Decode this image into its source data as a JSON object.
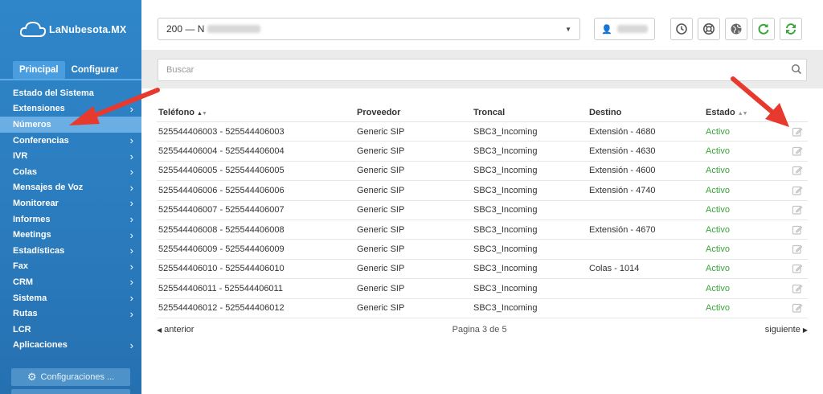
{
  "app": {
    "brand": "LaNubesota.MX"
  },
  "sidebar": {
    "tabs": [
      {
        "label": "Principal",
        "active": true
      },
      {
        "label": "Configurar",
        "active": false
      }
    ],
    "items": [
      {
        "label": "Estado del Sistema",
        "has_children": false,
        "active": false
      },
      {
        "label": "Extensiones",
        "has_children": true,
        "active": false
      },
      {
        "label": "Números",
        "has_children": false,
        "active": true
      },
      {
        "label": "Conferencias",
        "has_children": true,
        "active": false
      },
      {
        "label": "IVR",
        "has_children": true,
        "active": false
      },
      {
        "label": "Colas",
        "has_children": true,
        "active": false
      },
      {
        "label": "Mensajes de Voz",
        "has_children": true,
        "active": false
      },
      {
        "label": "Monitorear",
        "has_children": true,
        "active": false
      },
      {
        "label": "Informes",
        "has_children": true,
        "active": false
      },
      {
        "label": "Meetings",
        "has_children": true,
        "active": false
      },
      {
        "label": "Estadísticas",
        "has_children": true,
        "active": false
      },
      {
        "label": "Fax",
        "has_children": true,
        "active": false
      },
      {
        "label": "CRM",
        "has_children": true,
        "active": false
      },
      {
        "label": "Sistema",
        "has_children": true,
        "active": false
      },
      {
        "label": "Rutas",
        "has_children": true,
        "active": false
      },
      {
        "label": "LCR",
        "has_children": false,
        "active": false
      },
      {
        "label": "Aplicaciones",
        "has_children": true,
        "active": false
      }
    ],
    "config_button": "Configuraciones ..."
  },
  "topbar": {
    "company_select_value": "200 — N",
    "toolbar_icons": [
      "clock-icon",
      "lifebuoy-icon",
      "globe-icon",
      "refresh-icon",
      "sync-icon"
    ]
  },
  "search": {
    "placeholder": "Buscar"
  },
  "table": {
    "headers": [
      "Teléfono",
      "Proveedor",
      "Troncal",
      "Destino",
      "Estado"
    ],
    "rows": [
      {
        "telefono": "525544406003 - 525544406003",
        "proveedor": "Generic SIP",
        "troncal": "SBC3_Incoming",
        "destino": "Extensión - 4680",
        "estado": "Activo"
      },
      {
        "telefono": "525544406004 - 525544406004",
        "proveedor": "Generic SIP",
        "troncal": "SBC3_Incoming",
        "destino": "Extensión - 4630",
        "estado": "Activo"
      },
      {
        "telefono": "525544406005 - 525544406005",
        "proveedor": "Generic SIP",
        "troncal": "SBC3_Incoming",
        "destino": "Extensión - 4600",
        "estado": "Activo"
      },
      {
        "telefono": "525544406006 - 525544406006",
        "proveedor": "Generic SIP",
        "troncal": "SBC3_Incoming",
        "destino": "Extensión - 4740",
        "estado": "Activo"
      },
      {
        "telefono": "525544406007 - 525544406007",
        "proveedor": "Generic SIP",
        "troncal": "SBC3_Incoming",
        "destino": "",
        "estado": "Activo"
      },
      {
        "telefono": "525544406008 - 525544406008",
        "proveedor": "Generic SIP",
        "troncal": "SBC3_Incoming",
        "destino": "Extensión - 4670",
        "estado": "Activo"
      },
      {
        "telefono": "525544406009 - 525544406009",
        "proveedor": "Generic SIP",
        "troncal": "SBC3_Incoming",
        "destino": "",
        "estado": "Activo"
      },
      {
        "telefono": "525544406010 - 525544406010",
        "proveedor": "Generic SIP",
        "troncal": "SBC3_Incoming",
        "destino": "Colas - 1014",
        "estado": "Activo"
      },
      {
        "telefono": "525544406011 - 525544406011",
        "proveedor": "Generic SIP",
        "troncal": "SBC3_Incoming",
        "destino": "",
        "estado": "Activo"
      },
      {
        "telefono": "525544406012 - 525544406012",
        "proveedor": "Generic SIP",
        "troncal": "SBC3_Incoming",
        "destino": "",
        "estado": "Activo"
      }
    ]
  },
  "pager": {
    "prev": "anterior",
    "info": "Pagina 3 de 5",
    "next": "siguiente"
  },
  "colors": {
    "sidebar": "#2a7bbd",
    "status_active": "#3aa53a",
    "annotation_arrow": "#e8392f",
    "refresh_green": "#3aa53a"
  }
}
